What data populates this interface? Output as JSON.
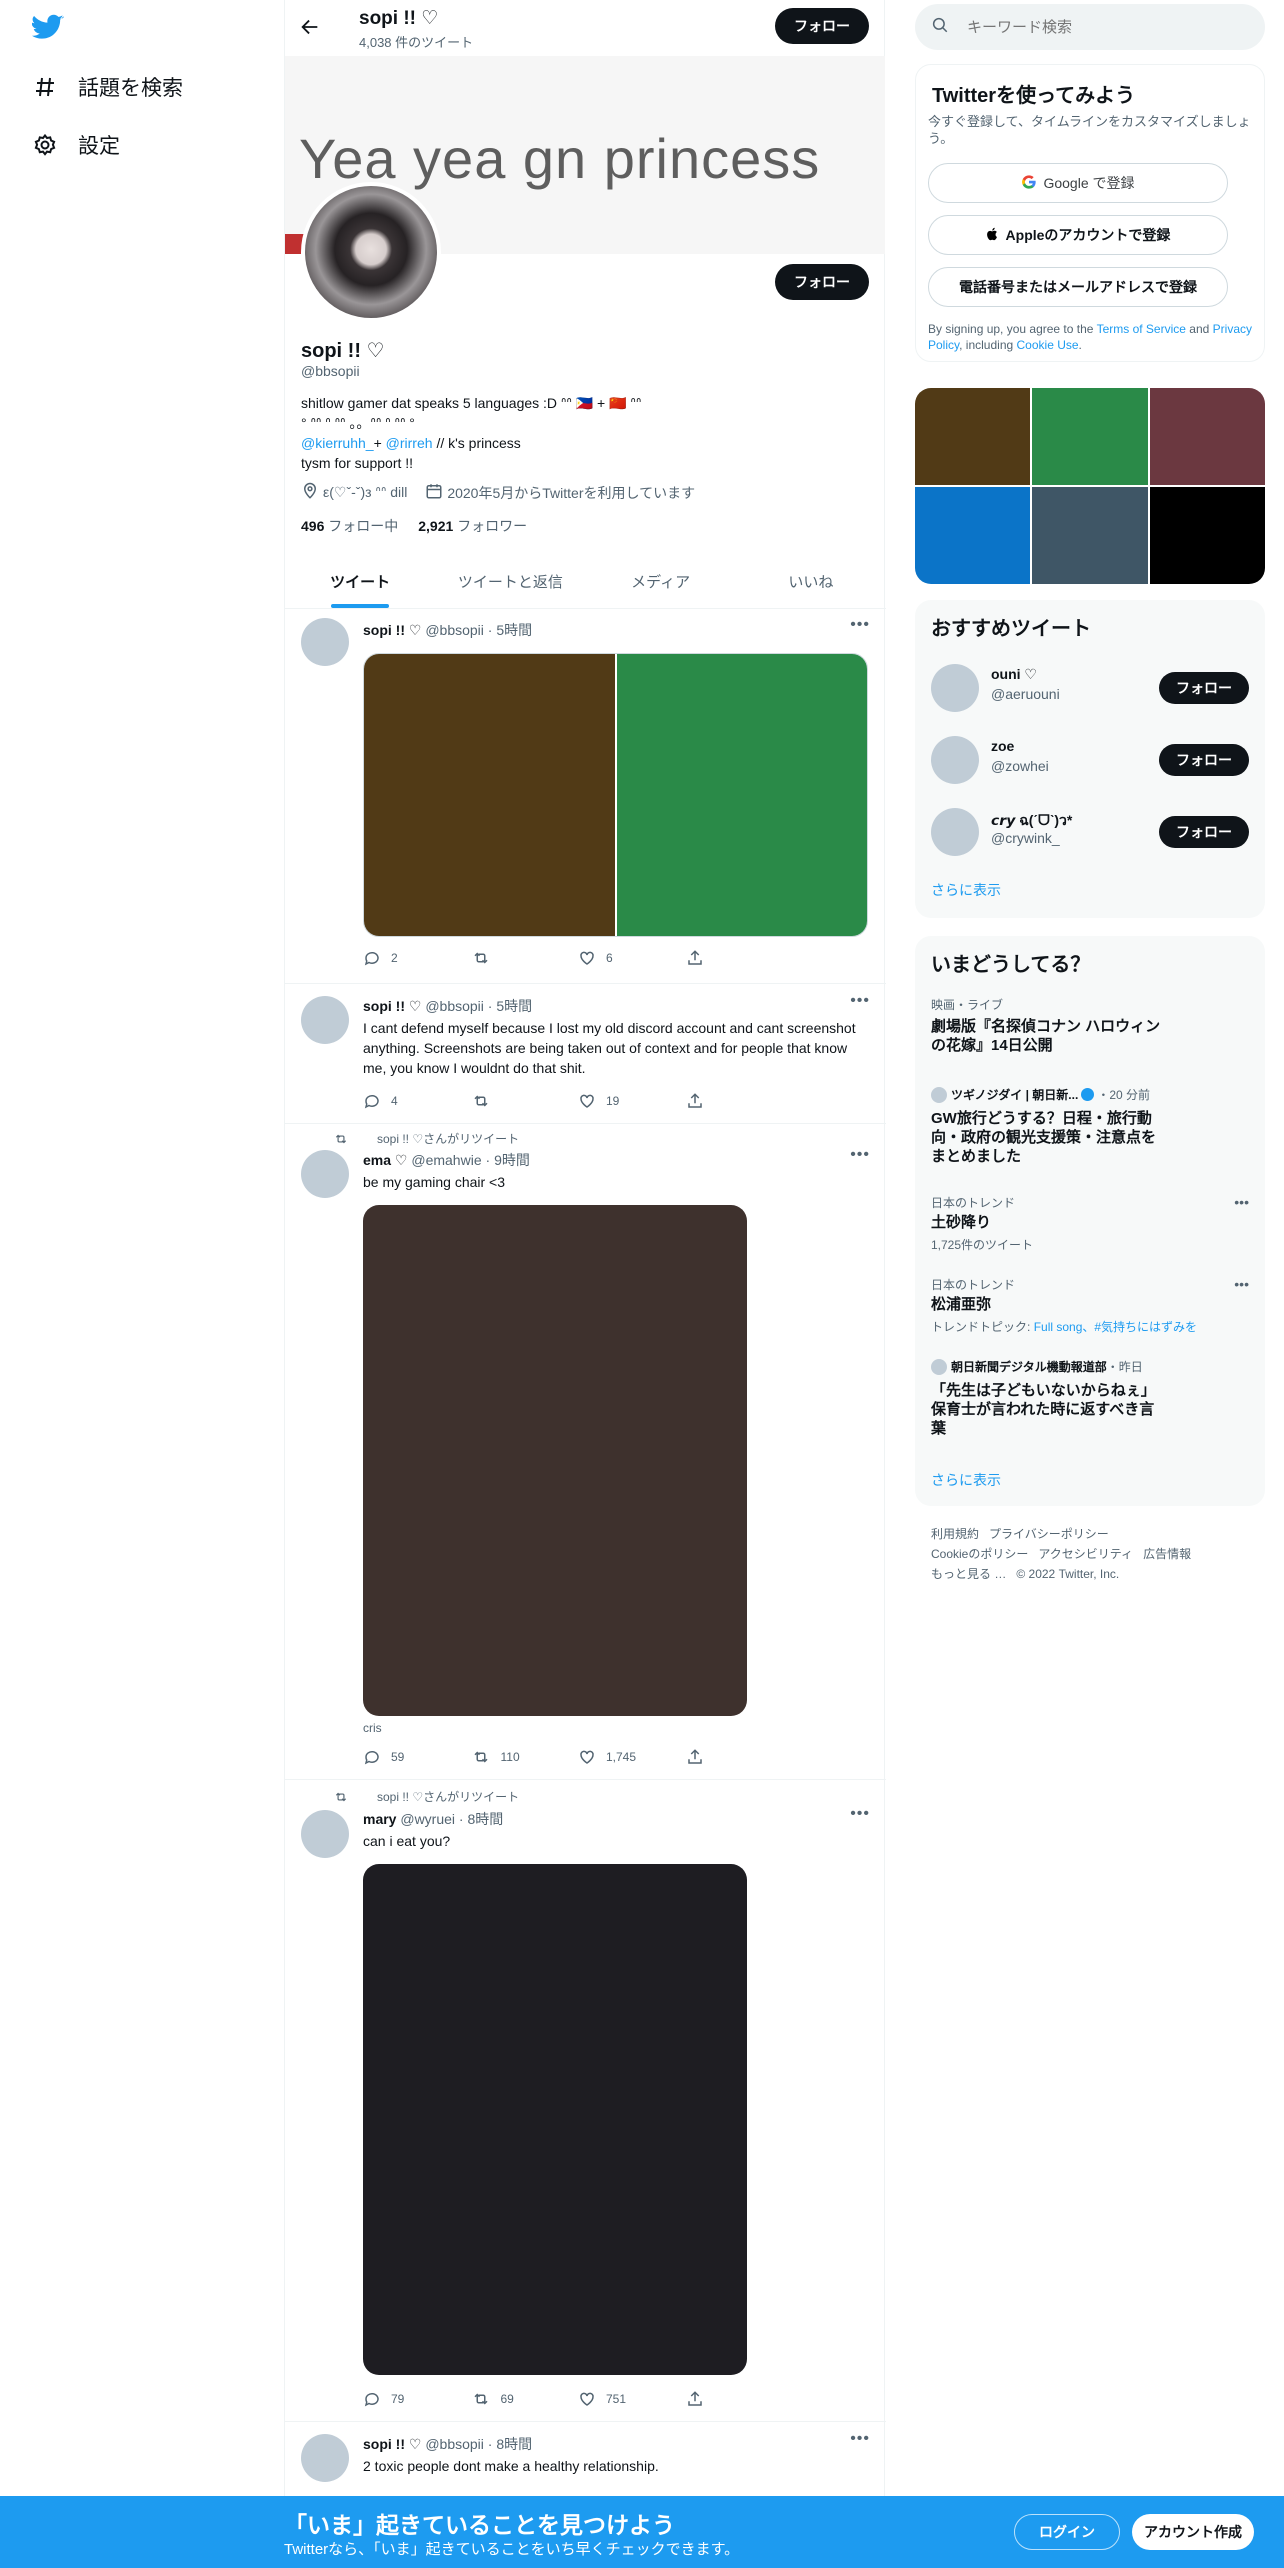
{
  "sidebar": {
    "explore_label": "話題を検索",
    "settings_label": "設定"
  },
  "header": {
    "name": "sopi !! ♡",
    "tweet_count": "4,038 件のツイート",
    "follow_label": "フォロー"
  },
  "banner": {
    "text": "Yea yea gn princess"
  },
  "profile": {
    "follow_label": "フォロー",
    "name": "sopi !! ♡",
    "handle": "@bbsopii",
    "bio_line1": "shitlow gamer dat speaks 5 languages :D ᐢᐢ 🇵🇭 + 🇨🇳 ᐢᐢ",
    "bio_line2": "° ᐢᐢ ᐢ ᐢᐢ 。。ᐢᐢ ᐢ ᐢᐢ °",
    "bio_link1": "@kierruhh_",
    "bio_plus": "+",
    "bio_link2": "@rirreh",
    "bio_rest": "// k's princess",
    "bio_line4": "tysm for support !!",
    "location": "ε(♡ˇ-ˇ)з ᐢᐢ dill",
    "joined": "2020年5月からTwitterを利用しています",
    "following_count": "496",
    "following_label": "フォロー中",
    "followers_count": "2,921",
    "followers_label": "フォロワー"
  },
  "tabs": [
    "ツイート",
    "ツイートと返信",
    "メディア",
    "いいね"
  ],
  "tweets": [
    {
      "name": "sopi !! ♡",
      "handle": "@bbsopii",
      "time": "5時間",
      "replies": "2",
      "retweets": "",
      "likes": "6",
      "media_colors": [
        "#513a16",
        "#2a8a48"
      ]
    },
    {
      "name": "sopi !! ♡",
      "handle": "@bbsopii",
      "time": "5時間",
      "text": "I cant defend myself because I lost my old discord account and cant screenshot anything. Screenshots are being taken out of context and for people that know me, you know I wouldnt do that shit.",
      "replies": "4",
      "retweets": "",
      "likes": "19"
    },
    {
      "retweeted_by": "sopi !! ♡さんがリツイート",
      "name": "ema ♡",
      "handle": "@emahwie",
      "time": "9時間",
      "text": "be my gaming chair <3",
      "media_color": "#3e312d",
      "caption": "cris",
      "replies": "59",
      "retweets": "110",
      "likes": "1,745"
    },
    {
      "retweeted_by": "sopi !! ♡さんがリツイート",
      "name": "mary",
      "handle": "@wyruei",
      "time": "8時間",
      "text": "can i eat you?",
      "media_color": "#1e1d22",
      "replies": "79",
      "retweets": "69",
      "likes": "751"
    },
    {
      "name": "sopi !! ♡",
      "handle": "@bbsopii",
      "time": "8時間",
      "text": "2 toxic people dont make a healthy relationship."
    }
  ],
  "search": {
    "placeholder": "キーワード検索"
  },
  "signup": {
    "title": "Twitterを使ってみよう",
    "subtitle": "今すぐ登録して、タイムラインをカスタマイズしましょう。",
    "google": "Google で登録",
    "apple": "Appleのアカウントで登録",
    "phone": "電話番号またはメールアドレスで登録",
    "terms_pre": "By signing up, you agree to the",
    "terms_link": "Terms of Service",
    "terms_and": "and",
    "privacy_link": "Privacy Policy",
    "terms_including": ", including",
    "cookie_link": "Cookie Use",
    "terms_end": "."
  },
  "media_grid": {
    "colors": [
      "#513a16",
      "#2a8a48",
      "#6b3840",
      "#0b74c8",
      "#3f5666",
      "#000000"
    ]
  },
  "recommended": {
    "title": "おすすめツイート",
    "users": [
      {
        "name": "ouni ♡",
        "handle": "@aeruouni"
      },
      {
        "name": "zoe",
        "handle": "@zowhei"
      },
      {
        "name": "𝙘𝙧𝙮 ฉ(ˊᗜˋ)ว*",
        "handle": "@crywink_"
      }
    ],
    "follow_label": "フォロー",
    "show_more": "さらに表示"
  },
  "trends": {
    "title": "いまどうしてる？",
    "items": [
      {
        "context": "映画・ライブ",
        "title": "劇場版『名探偵コナン ハロウィンの花嫁』14日公開"
      },
      {
        "source": "ツギノジダイ | 朝日新...",
        "time": "・20 分前",
        "title": "GW旅行どうする？日程・旅行動向・政府の観光支援策・注意点をまとめました"
      },
      {
        "context": "日本のトレンド",
        "title": "土砂降り",
        "meta": "1,725件のツイート"
      },
      {
        "context": "日本のトレンド",
        "title": "松浦亜弥",
        "meta_prefix": "トレンドトピック:",
        "meta_links": "Full song、#気持ちにはずみを"
      },
      {
        "source": "朝日新聞デジタル機動報道部",
        "time": "・昨日",
        "title": "「先生は子どもいないからねぇ」保育士が言われた時に返すべき言葉"
      }
    ],
    "show_more": "さらに表示"
  },
  "footer": {
    "terms": "利用規約",
    "privacy": "プライバシーポリシー",
    "cookie": "Cookieのポリシー",
    "accessibility": "アクセシビリティ",
    "ads": "広告情報",
    "more": "もっと見る …",
    "copyright": "© 2022 Twitter, Inc."
  },
  "bottom_bar": {
    "title": "「いま」起きていることを見つけよう",
    "subtitle": "Twitterなら、「いま」起きていることをいち早くチェックできます。",
    "login": "ログイン",
    "signup": "アカウント作成"
  }
}
